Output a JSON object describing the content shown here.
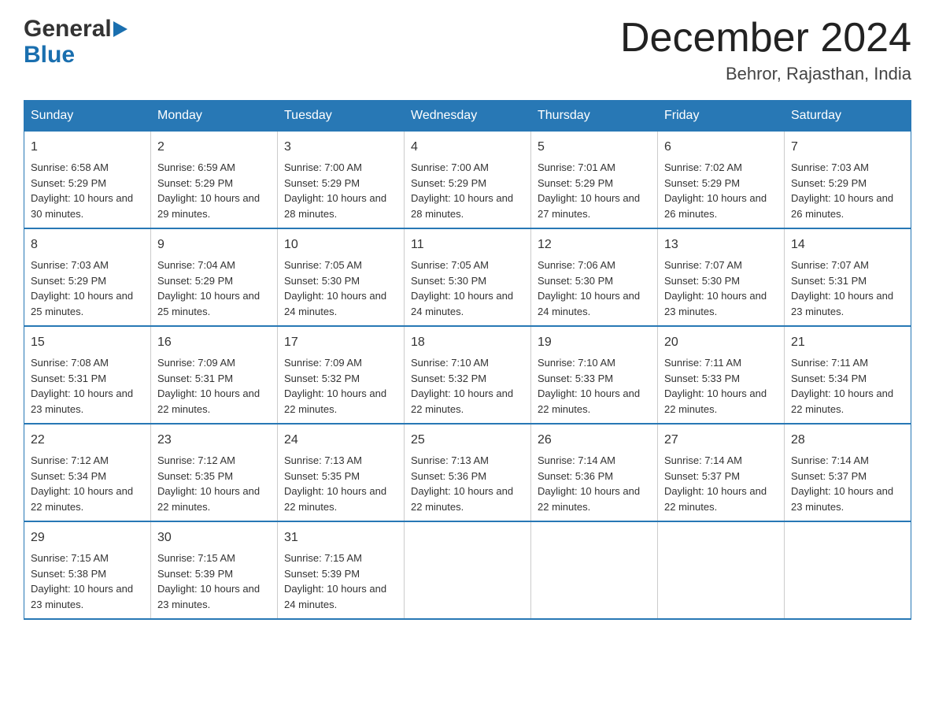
{
  "logo": {
    "general": "General",
    "blue": "Blue"
  },
  "title": {
    "month": "December 2024",
    "location": "Behror, Rajasthan, India"
  },
  "days_of_week": [
    "Sunday",
    "Monday",
    "Tuesday",
    "Wednesday",
    "Thursday",
    "Friday",
    "Saturday"
  ],
  "weeks": [
    [
      {
        "day": "1",
        "sunrise": "Sunrise: 6:58 AM",
        "sunset": "Sunset: 5:29 PM",
        "daylight": "Daylight: 10 hours and 30 minutes."
      },
      {
        "day": "2",
        "sunrise": "Sunrise: 6:59 AM",
        "sunset": "Sunset: 5:29 PM",
        "daylight": "Daylight: 10 hours and 29 minutes."
      },
      {
        "day": "3",
        "sunrise": "Sunrise: 7:00 AM",
        "sunset": "Sunset: 5:29 PM",
        "daylight": "Daylight: 10 hours and 28 minutes."
      },
      {
        "day": "4",
        "sunrise": "Sunrise: 7:00 AM",
        "sunset": "Sunset: 5:29 PM",
        "daylight": "Daylight: 10 hours and 28 minutes."
      },
      {
        "day": "5",
        "sunrise": "Sunrise: 7:01 AM",
        "sunset": "Sunset: 5:29 PM",
        "daylight": "Daylight: 10 hours and 27 minutes."
      },
      {
        "day": "6",
        "sunrise": "Sunrise: 7:02 AM",
        "sunset": "Sunset: 5:29 PM",
        "daylight": "Daylight: 10 hours and 26 minutes."
      },
      {
        "day": "7",
        "sunrise": "Sunrise: 7:03 AM",
        "sunset": "Sunset: 5:29 PM",
        "daylight": "Daylight: 10 hours and 26 minutes."
      }
    ],
    [
      {
        "day": "8",
        "sunrise": "Sunrise: 7:03 AM",
        "sunset": "Sunset: 5:29 PM",
        "daylight": "Daylight: 10 hours and 25 minutes."
      },
      {
        "day": "9",
        "sunrise": "Sunrise: 7:04 AM",
        "sunset": "Sunset: 5:29 PM",
        "daylight": "Daylight: 10 hours and 25 minutes."
      },
      {
        "day": "10",
        "sunrise": "Sunrise: 7:05 AM",
        "sunset": "Sunset: 5:30 PM",
        "daylight": "Daylight: 10 hours and 24 minutes."
      },
      {
        "day": "11",
        "sunrise": "Sunrise: 7:05 AM",
        "sunset": "Sunset: 5:30 PM",
        "daylight": "Daylight: 10 hours and 24 minutes."
      },
      {
        "day": "12",
        "sunrise": "Sunrise: 7:06 AM",
        "sunset": "Sunset: 5:30 PM",
        "daylight": "Daylight: 10 hours and 24 minutes."
      },
      {
        "day": "13",
        "sunrise": "Sunrise: 7:07 AM",
        "sunset": "Sunset: 5:30 PM",
        "daylight": "Daylight: 10 hours and 23 minutes."
      },
      {
        "day": "14",
        "sunrise": "Sunrise: 7:07 AM",
        "sunset": "Sunset: 5:31 PM",
        "daylight": "Daylight: 10 hours and 23 minutes."
      }
    ],
    [
      {
        "day": "15",
        "sunrise": "Sunrise: 7:08 AM",
        "sunset": "Sunset: 5:31 PM",
        "daylight": "Daylight: 10 hours and 23 minutes."
      },
      {
        "day": "16",
        "sunrise": "Sunrise: 7:09 AM",
        "sunset": "Sunset: 5:31 PM",
        "daylight": "Daylight: 10 hours and 22 minutes."
      },
      {
        "day": "17",
        "sunrise": "Sunrise: 7:09 AM",
        "sunset": "Sunset: 5:32 PM",
        "daylight": "Daylight: 10 hours and 22 minutes."
      },
      {
        "day": "18",
        "sunrise": "Sunrise: 7:10 AM",
        "sunset": "Sunset: 5:32 PM",
        "daylight": "Daylight: 10 hours and 22 minutes."
      },
      {
        "day": "19",
        "sunrise": "Sunrise: 7:10 AM",
        "sunset": "Sunset: 5:33 PM",
        "daylight": "Daylight: 10 hours and 22 minutes."
      },
      {
        "day": "20",
        "sunrise": "Sunrise: 7:11 AM",
        "sunset": "Sunset: 5:33 PM",
        "daylight": "Daylight: 10 hours and 22 minutes."
      },
      {
        "day": "21",
        "sunrise": "Sunrise: 7:11 AM",
        "sunset": "Sunset: 5:34 PM",
        "daylight": "Daylight: 10 hours and 22 minutes."
      }
    ],
    [
      {
        "day": "22",
        "sunrise": "Sunrise: 7:12 AM",
        "sunset": "Sunset: 5:34 PM",
        "daylight": "Daylight: 10 hours and 22 minutes."
      },
      {
        "day": "23",
        "sunrise": "Sunrise: 7:12 AM",
        "sunset": "Sunset: 5:35 PM",
        "daylight": "Daylight: 10 hours and 22 minutes."
      },
      {
        "day": "24",
        "sunrise": "Sunrise: 7:13 AM",
        "sunset": "Sunset: 5:35 PM",
        "daylight": "Daylight: 10 hours and 22 minutes."
      },
      {
        "day": "25",
        "sunrise": "Sunrise: 7:13 AM",
        "sunset": "Sunset: 5:36 PM",
        "daylight": "Daylight: 10 hours and 22 minutes."
      },
      {
        "day": "26",
        "sunrise": "Sunrise: 7:14 AM",
        "sunset": "Sunset: 5:36 PM",
        "daylight": "Daylight: 10 hours and 22 minutes."
      },
      {
        "day": "27",
        "sunrise": "Sunrise: 7:14 AM",
        "sunset": "Sunset: 5:37 PM",
        "daylight": "Daylight: 10 hours and 22 minutes."
      },
      {
        "day": "28",
        "sunrise": "Sunrise: 7:14 AM",
        "sunset": "Sunset: 5:37 PM",
        "daylight": "Daylight: 10 hours and 23 minutes."
      }
    ],
    [
      {
        "day": "29",
        "sunrise": "Sunrise: 7:15 AM",
        "sunset": "Sunset: 5:38 PM",
        "daylight": "Daylight: 10 hours and 23 minutes."
      },
      {
        "day": "30",
        "sunrise": "Sunrise: 7:15 AM",
        "sunset": "Sunset: 5:39 PM",
        "daylight": "Daylight: 10 hours and 23 minutes."
      },
      {
        "day": "31",
        "sunrise": "Sunrise: 7:15 AM",
        "sunset": "Sunset: 5:39 PM",
        "daylight": "Daylight: 10 hours and 24 minutes."
      },
      {
        "day": "",
        "sunrise": "",
        "sunset": "",
        "daylight": ""
      },
      {
        "day": "",
        "sunrise": "",
        "sunset": "",
        "daylight": ""
      },
      {
        "day": "",
        "sunrise": "",
        "sunset": "",
        "daylight": ""
      },
      {
        "day": "",
        "sunrise": "",
        "sunset": "",
        "daylight": ""
      }
    ]
  ]
}
